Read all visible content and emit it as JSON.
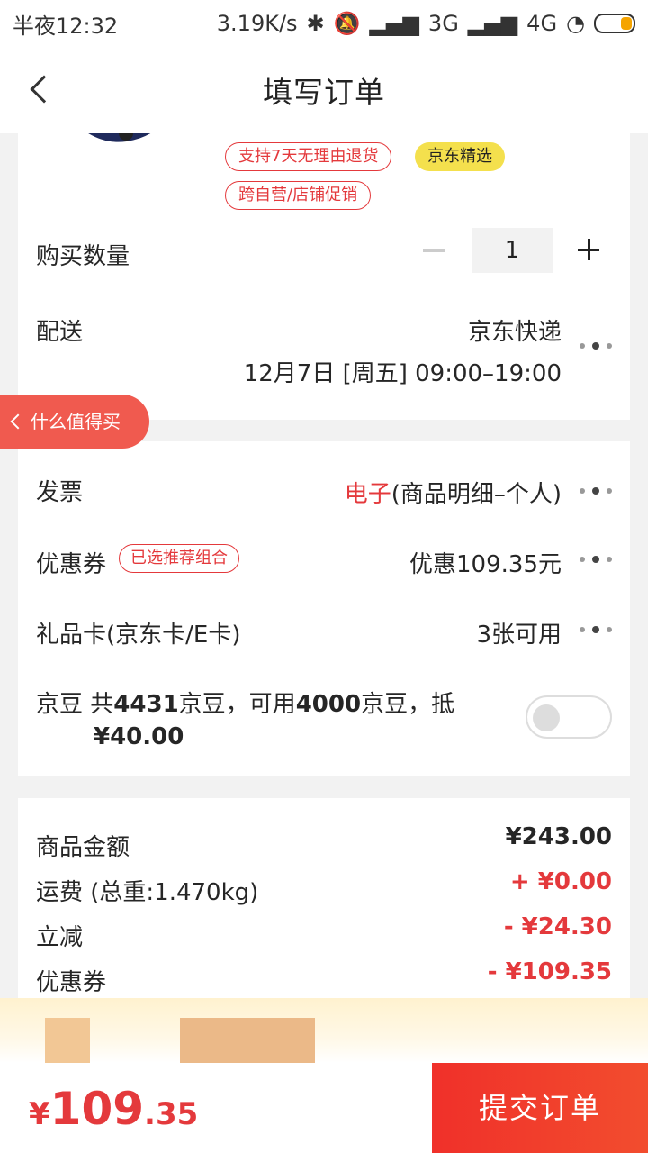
{
  "status_bar": {
    "time": "半夜12:32",
    "network_speed": "3.19K/s",
    "net1": "3G",
    "net2": "4G"
  },
  "nav": {
    "title": "填写订单"
  },
  "product": {
    "tags": [
      "支持7天无理由退货",
      "京东精选",
      "跨自营/店铺促销"
    ]
  },
  "quantity": {
    "label": "购买数量",
    "value": "1"
  },
  "delivery": {
    "label": "配送",
    "method": "京东快递",
    "time": "12月7日 [周五] 09:00–19:00"
  },
  "side_button": {
    "label": "什么值得买"
  },
  "invoice": {
    "label": "发票",
    "type_red": "电子",
    "detail": "(商品明细–个人)"
  },
  "coupon": {
    "label": "优惠券",
    "tag": "已选推荐组合",
    "value": "优惠109.35元"
  },
  "gift_card": {
    "label": "礼品卡(京东卡/E卡)",
    "value": "3张可用"
  },
  "jingdou": {
    "label": "京豆",
    "t1": "共",
    "total": "4431",
    "t2": "京豆，可用",
    "usable": "4000",
    "t3": "京豆，抵",
    "deduct": "¥40.00",
    "enabled": false
  },
  "summary": {
    "items": [
      {
        "label": "商品金额",
        "value": "¥243.00",
        "color": "#262626"
      },
      {
        "label": "运费 (总重:1.470kg)",
        "value": "+ ¥0.00",
        "color": "#e4393c"
      },
      {
        "label": "立减",
        "value": "- ¥24.30",
        "color": "#e4393c"
      },
      {
        "label": "优惠券",
        "value": "- ¥109.35",
        "color": "#e4393c"
      }
    ]
  },
  "bottom": {
    "currency": "¥",
    "total_int": "109",
    "total_dec": ".35",
    "submit_label": "提交订单"
  },
  "colors": {
    "accent": "#e4393c",
    "tag_yellow": "#f4e04d",
    "side_button": "#f05a4f"
  }
}
